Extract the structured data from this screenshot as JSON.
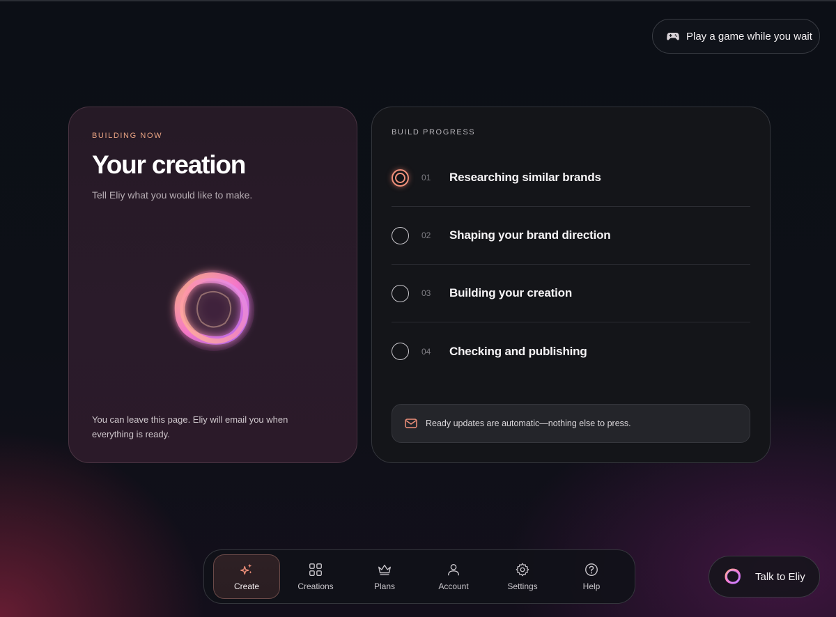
{
  "header": {
    "game_button_label": "Play a game while you wait"
  },
  "creation_card": {
    "eyebrow": "BUILDING NOW",
    "title": "Your creation",
    "subtitle": "Tell Eliy what you would like to make.",
    "footnote": "You can leave this page. Eliy will email you when everything is ready."
  },
  "progress_card": {
    "eyebrow": "BUILD PROGRESS",
    "steps": [
      {
        "number": "01",
        "label": "Researching similar brands",
        "status": "active"
      },
      {
        "number": "02",
        "label": "Shaping your brand direction",
        "status": "pending"
      },
      {
        "number": "03",
        "label": "Building your creation",
        "status": "pending"
      },
      {
        "number": "04",
        "label": "Checking and publishing",
        "status": "pending"
      }
    ],
    "notice": "Ready updates are automatic—nothing else to press."
  },
  "nav": {
    "items": [
      {
        "label": "Create",
        "icon": "sparkles-icon",
        "active": true
      },
      {
        "label": "Creations",
        "icon": "grid-icon",
        "active": false
      },
      {
        "label": "Plans",
        "icon": "crown-icon",
        "active": false
      },
      {
        "label": "Account",
        "icon": "user-icon",
        "active": false
      },
      {
        "label": "Settings",
        "icon": "gear-icon",
        "active": false
      },
      {
        "label": "Help",
        "icon": "help-circle-icon",
        "active": false
      }
    ]
  },
  "assistant": {
    "button_label": "Talk to Eliy"
  },
  "colors": {
    "accent": "#f0907a",
    "background": "#0c0f16",
    "card_left": "#2a1b2a",
    "card_right": "#141519"
  }
}
